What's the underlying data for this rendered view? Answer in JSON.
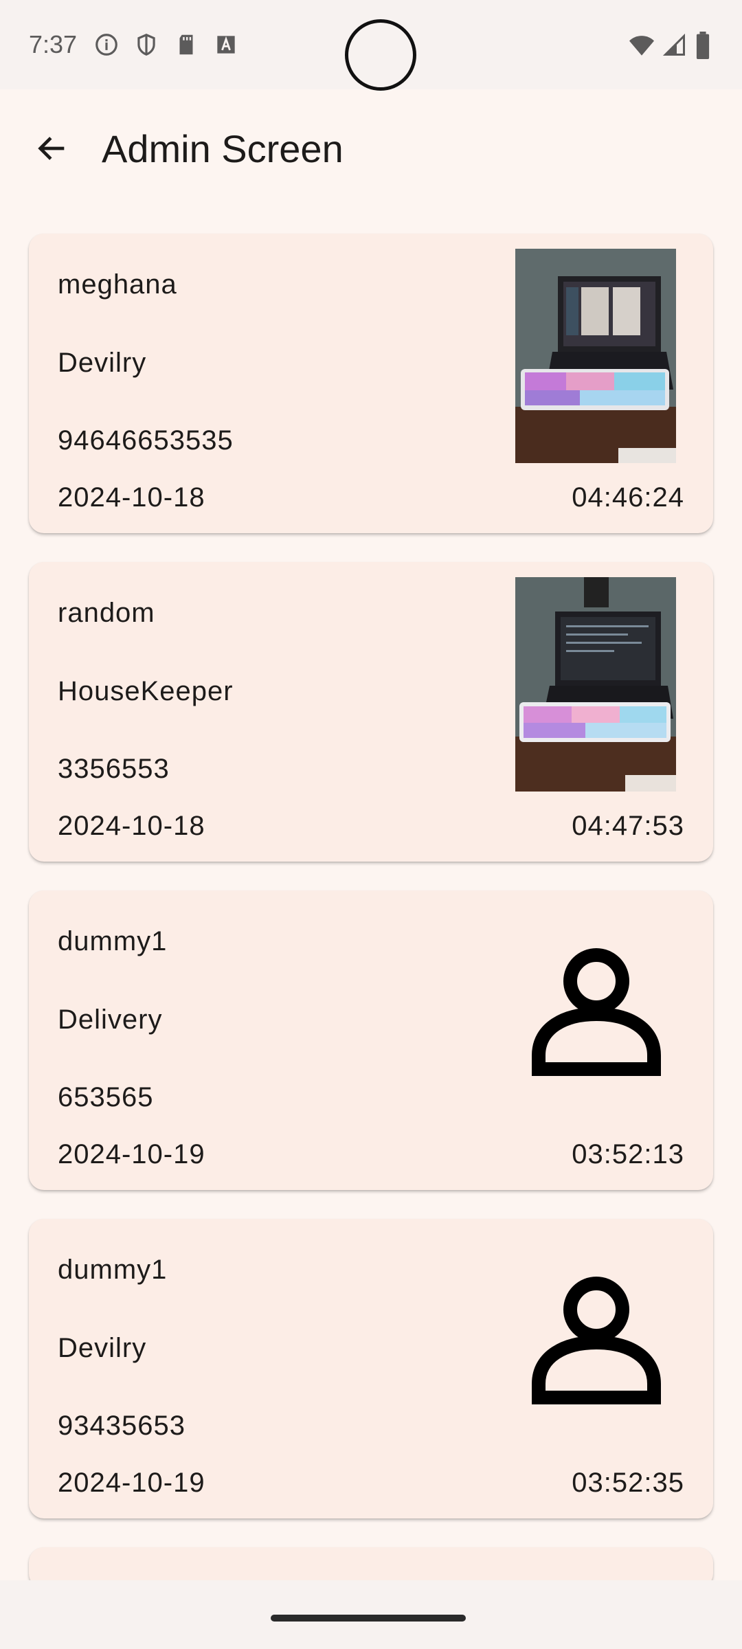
{
  "status_bar": {
    "time": "7:37",
    "left_icons": [
      "info-icon",
      "shield-icon",
      "sd-card-icon",
      "font-a-icon"
    ],
    "right_icons": [
      "wifi-icon",
      "signal-icon",
      "battery-icon"
    ]
  },
  "app_bar": {
    "title": "Admin Screen",
    "back_icon": "arrow-left-icon"
  },
  "entries": [
    {
      "name": "meghana",
      "role": "Devilry",
      "phone": "94646653535",
      "date": "2024-10-18",
      "time": "04:46:24",
      "image": "photo"
    },
    {
      "name": "random",
      "role": "HouseKeeper",
      "phone": "3356553",
      "date": "2024-10-18",
      "time": "04:47:53",
      "image": "photo"
    },
    {
      "name": "dummy1",
      "role": "Delivery",
      "phone": "653565",
      "date": "2024-10-19",
      "time": "03:52:13",
      "image": "person-icon"
    },
    {
      "name": "dummy1",
      "role": "Devilry",
      "phone": "93435653",
      "date": "2024-10-19",
      "time": "03:52:35",
      "image": "person-icon"
    }
  ]
}
